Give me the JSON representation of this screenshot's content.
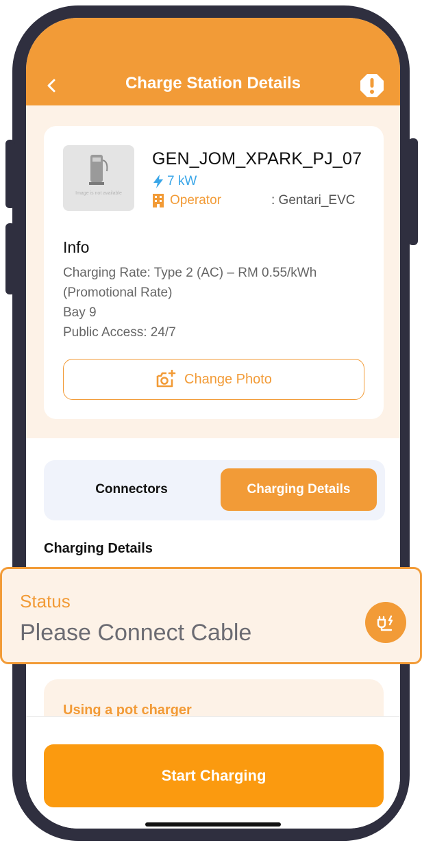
{
  "header": {
    "title": "Charge Station Details",
    "back_icon": "chevron-left-icon",
    "alert_icon": "alert-octagon-icon"
  },
  "station": {
    "name": "GEN_JOM_XPARK_PJ_07",
    "image_caption": "Image is not available",
    "power": "7 kW",
    "power_icon": "lightning-icon",
    "operator_label": "Operator",
    "operator_icon": "building-icon",
    "operator_value": ": Gentari_EVC"
  },
  "info": {
    "title": "Info",
    "lines": [
      "Charging Rate: Type 2 (AC) – RM 0.55/kWh",
      "(Promotional Rate)",
      "Bay 9",
      "Public Access: 24/7"
    ],
    "change_photo_label": "Change Photo",
    "change_photo_icon": "camera-add-icon"
  },
  "tabs": {
    "connectors": "Connectors",
    "charging_details": "Charging Details",
    "selected": "charging_details"
  },
  "charging_details": {
    "section_title": "Charging Details",
    "status_label": "Status",
    "status_value": "Please Connect Cable",
    "status_icon": "plug-icon",
    "tip_title": "Using a pot charger"
  },
  "actions": {
    "start_charging": "Start Charging"
  },
  "colors": {
    "primary": "#f29b37",
    "button": "#fb9a0f",
    "accent_blue": "#3aa6e8",
    "background_tint": "#fdf2e7",
    "frame": "#2f2f3f"
  }
}
